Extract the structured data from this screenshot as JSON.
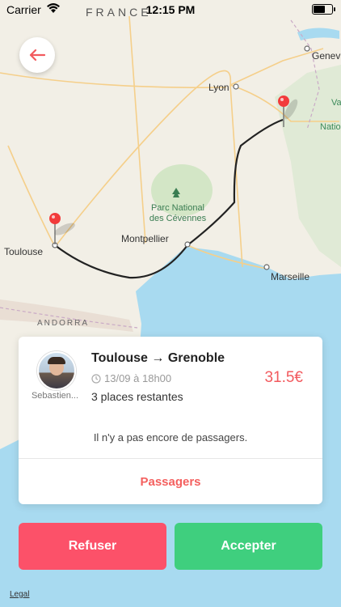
{
  "status_bar": {
    "carrier": "Carrier",
    "time": "12:15 PM"
  },
  "map": {
    "labels": {
      "country": "FRANCE",
      "lyon": "Lyon",
      "geneva": "Geneva",
      "montpellier": "Montpellier",
      "marseille": "Marseille",
      "toulouse": "Toulouse",
      "andorra": "ANDORRA",
      "park_line1": "Parc National",
      "park_line2": "des Cévennes",
      "va": "Va",
      "natio": "Natio"
    },
    "colors": {
      "land": "#f2efe6",
      "sea": "#a8daf0",
      "route": "#222222",
      "pin": "#f23b3b"
    }
  },
  "trip": {
    "driver_name": "Sebastien...",
    "route": "Toulouse → Grenoble",
    "datetime": "13/09 à 18h00",
    "seats": "3 places restantes",
    "price": "31.5€",
    "no_passengers": "Il n'y a pas encore de passagers.",
    "passengers_label": "Passagers"
  },
  "actions": {
    "refuse": "Refuser",
    "accept": "Accepter"
  },
  "footer": {
    "legal": "Legal"
  },
  "colors": {
    "accent": "#f25a5e",
    "refuse": "#fc5169",
    "accept": "#3fcf7e"
  }
}
